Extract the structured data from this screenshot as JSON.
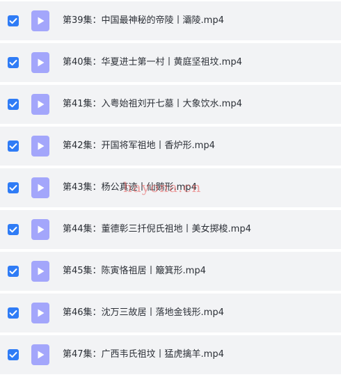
{
  "colors": {
    "row_background": "#f2f3f5",
    "checkbox_checked": "#2f7cf6",
    "video_icon_fill": "#a3a6fb",
    "text": "#2b2f36"
  },
  "files": [
    {
      "name": "第39集：中国最神秘的帝陵丨灞陵.mp4",
      "checked": true,
      "icon": "video-file-icon"
    },
    {
      "name": "第40集：华夏进士第一村丨黄庭坚祖坟.mp4",
      "checked": true,
      "icon": "video-file-icon"
    },
    {
      "name": "第41集：入粤始祖刘开七墓丨大象饮水.mp4",
      "checked": true,
      "icon": "video-file-icon"
    },
    {
      "name": "第42集：开国将军祖地丨香炉形.mp4",
      "checked": true,
      "icon": "video-file-icon"
    },
    {
      "name": "第43集：杨公真迹丨仙鹅形.mp4",
      "checked": true,
      "icon": "video-file-icon"
    },
    {
      "name": "第44集：董德彰三扦倪氏祖地丨美女掷梭.mp4",
      "checked": true,
      "icon": "video-file-icon"
    },
    {
      "name": "第45集：陈寅恪祖居丨簸箕形.mp4",
      "checked": true,
      "icon": "video-file-icon"
    },
    {
      "name": "第46集：沈万三故居丨落地金钱形.mp4",
      "checked": true,
      "icon": "video-file-icon"
    },
    {
      "name": "第47集：广西韦氏祖坟丨猛虎擒羊.mp4",
      "checked": true,
      "icon": "video-file-icon"
    }
  ],
  "watermark": "hayona.cn"
}
